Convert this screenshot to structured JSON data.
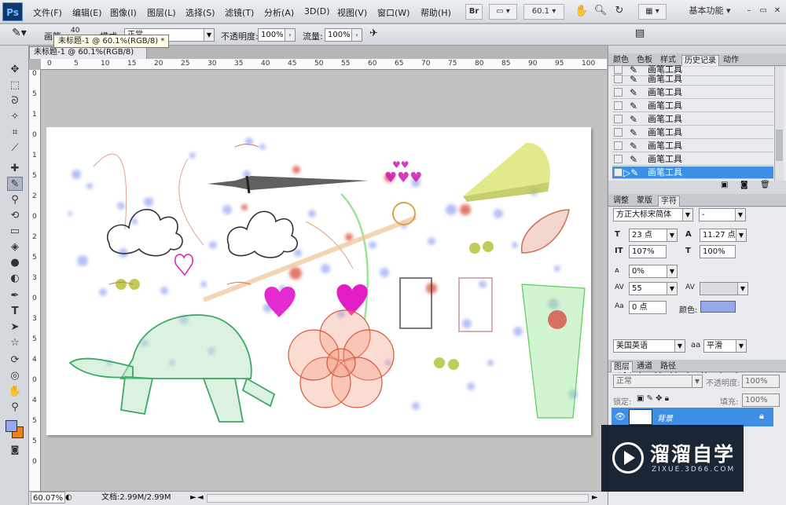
{
  "app": {
    "logo": "Ps"
  },
  "menu": [
    "文件(F)",
    "编辑(E)",
    "图像(I)",
    "图层(L)",
    "选择(S)",
    "滤镜(T)",
    "分析(A)",
    "3D(D)",
    "视图(V)",
    "窗口(W)",
    "帮助(H)"
  ],
  "menubar": {
    "br_button": "Br",
    "zoom": "60.1",
    "workspace": "基本功能"
  },
  "options": {
    "tool_label": "画笔:",
    "mode_label": "模式:",
    "mode_value": "正常",
    "opacity_label": "不透明度:",
    "opacity_value": "100%",
    "flow_label": "流量:",
    "flow_value": "100%",
    "brush_size": "40"
  },
  "tooltip": "未标题-1 @ 60.1%(RGB/8) *",
  "document": {
    "tab_title": "未标题-1 @ 60.1%(RGB/8)",
    "close": "×"
  },
  "ruler": {
    "h": [
      "0",
      "5",
      "10",
      "15",
      "20",
      "25",
      "30",
      "35",
      "40",
      "45",
      "50",
      "55",
      "60",
      "65",
      "70",
      "75",
      "80",
      "85",
      "90",
      "95",
      "100"
    ],
    "v": [
      "0",
      "5",
      "1",
      "0",
      "1",
      "5",
      "2",
      "0",
      "2",
      "5",
      "3",
      "0",
      "3",
      "5",
      "4",
      "0",
      "4",
      "5",
      "5",
      "0"
    ]
  },
  "status": {
    "zoom": "60.07%",
    "doc": "文档:2.99M/2.99M"
  },
  "history": {
    "tabs": [
      "颜色",
      "色板",
      "样式",
      "历史记录",
      "动作"
    ],
    "items": [
      "画笔工具",
      "画笔工具",
      "画笔工具",
      "画笔工具",
      "画笔工具",
      "画笔工具",
      "画笔工具",
      "画笔工具",
      "画笔工具"
    ]
  },
  "character": {
    "tabs": [
      "调整",
      "蒙版",
      "字符"
    ],
    "font_family": "方正大标宋简体",
    "font_style": "-",
    "size": "23 点",
    "leading": "11.27 点",
    "vscale": "107%",
    "hscale": "100%",
    "tsume": "0%",
    "tracking": "55",
    "kerning": "",
    "baseline": "0 点",
    "color_label": "颜色:",
    "color": "#98a6ea",
    "language": "美国英语",
    "aa_label": "aa",
    "aa_value": "平滑",
    "format_buttons": [
      "T",
      "T",
      "TT",
      "Tт",
      "T¹",
      "T,",
      "T",
      "Ŧ"
    ]
  },
  "layers": {
    "tabs": [
      "图层",
      "通道",
      "路径"
    ],
    "blend": "正常",
    "opacity_label": "不透明度:",
    "opacity_value": "100%",
    "lock_label": "锁定:",
    "fill_label": "填充:",
    "fill_value": "100%",
    "layer_name": "背景"
  },
  "watermark": {
    "title": "溜溜自学",
    "subtitle": "ZIXUE.3D66.COM"
  }
}
